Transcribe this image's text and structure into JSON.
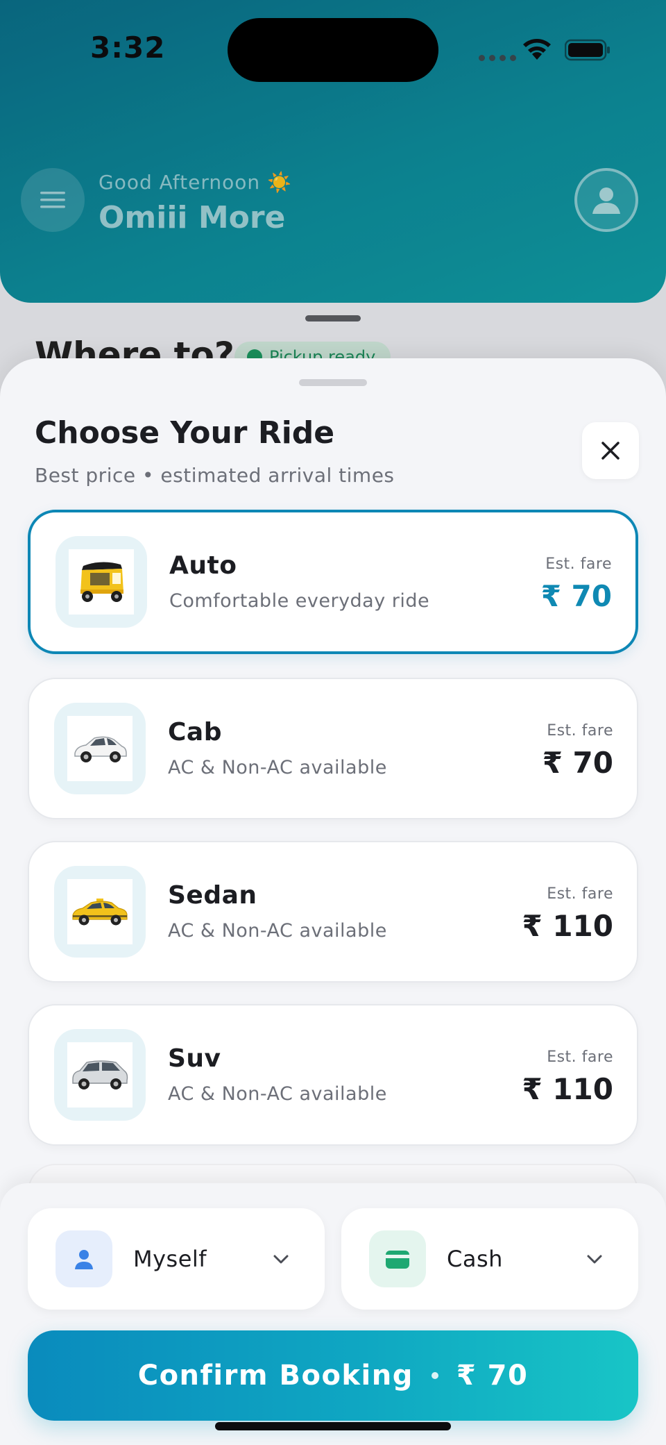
{
  "status_bar": {
    "time": "3:32"
  },
  "header": {
    "greeting": "Good Afternoon",
    "greeting_emoji": "☀️",
    "user_name": "Omiii More"
  },
  "background": {
    "where_to": "Where to?",
    "pickup_status": "Pickup ready"
  },
  "sheet": {
    "title": "Choose Your Ride",
    "subtitle": "Best price • estimated arrival times",
    "rides": [
      {
        "name": "Auto",
        "desc": "Comfortable everyday ride",
        "fare_label": "Est. fare",
        "fare": "₹ 70",
        "icon": "auto-rickshaw-icon",
        "selected": true
      },
      {
        "name": "Cab",
        "desc": "AC & Non-AC available",
        "fare_label": "Est. fare",
        "fare": "₹ 70",
        "icon": "hatchback-car-icon",
        "selected": false
      },
      {
        "name": " Sedan",
        "desc": "AC & Non-AC available",
        "fare_label": "Est. fare",
        "fare": "₹ 110",
        "icon": "sedan-taxi-icon",
        "selected": false
      },
      {
        "name": "Suv",
        "desc": "AC & Non-AC available",
        "fare_label": "Est. fare",
        "fare": "₹ 110",
        "icon": "suv-car-icon",
        "selected": false
      }
    ]
  },
  "footer": {
    "rider_label": "Myself",
    "payment_label": "Cash",
    "confirm_label": "Confirm Booking",
    "confirm_fare": "₹ 70"
  },
  "colors": {
    "accent": "#0d87b5",
    "header_gradient_start": "#0a6d87",
    "header_gradient_end": "#0f9ba3",
    "button_gradient_start": "#0a8bbd",
    "button_gradient_end": "#18c5c6"
  }
}
